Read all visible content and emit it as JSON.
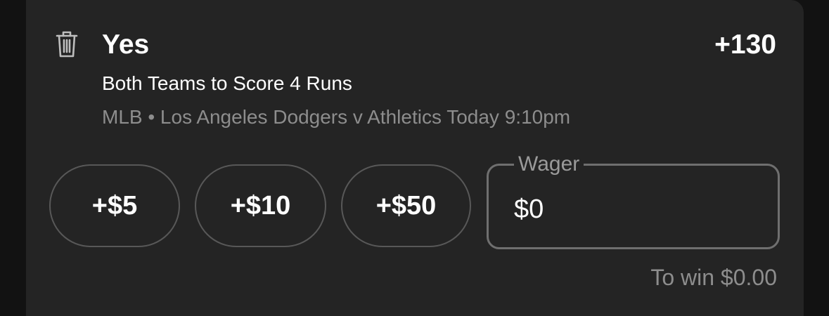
{
  "bet": {
    "selection": "Yes",
    "odds": "+130",
    "market": "Both Teams to Score 4 Runs",
    "event": "MLB • Los Angeles Dodgers v Athletics Today 9:10pm"
  },
  "quick_add": [
    {
      "label": "+$5"
    },
    {
      "label": "+$10"
    },
    {
      "label": "+$50"
    }
  ],
  "wager": {
    "label": "Wager",
    "value": "$0"
  },
  "to_win": "To win $0.00",
  "icons": {
    "remove": "trash-icon"
  },
  "colors": {
    "background": "#121212",
    "card": "#242424",
    "text_primary": "#ffffff",
    "text_secondary": "#8d8d8d",
    "border": "#585858"
  }
}
